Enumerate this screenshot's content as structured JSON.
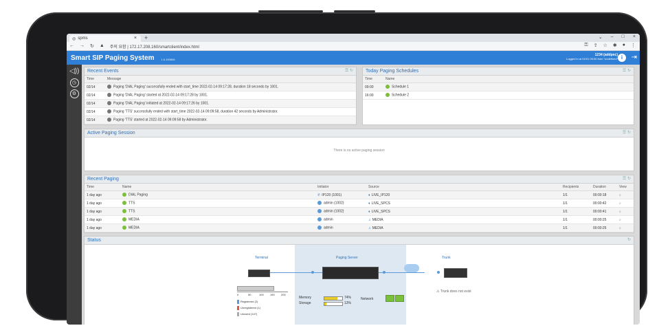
{
  "browser": {
    "tab_title": "spms",
    "new_tab": "+",
    "url": "주의 요함 | 172.17.208.160/smartclient/index.html"
  },
  "app": {
    "title": "Smart SIP Paging System",
    "version": "1.6.190806",
    "user_name": "1234 (addpec)",
    "login_info": "Logged in at 01/01 09:00 from \"undefined\""
  },
  "sidebar": {
    "items": [
      {
        "icon": "paging-icon"
      },
      {
        "icon": "clock-icon"
      },
      {
        "icon": "gear-icon"
      }
    ]
  },
  "recent_events": {
    "title": "Recent Events",
    "columns": [
      "Time",
      "Message"
    ],
    "rows": [
      {
        "time": "02/14",
        "message": "Paging 'DIAL Paging' successfully ended with start_time 2022-02-14 09:17:28, duration 18 seconds by 1001."
      },
      {
        "time": "02/14",
        "message": "Paging 'DIAL Paging' started at 2022-02-14 09:17:28 by 1001."
      },
      {
        "time": "02/14",
        "message": "Paging 'DIAL Paging' initiated at 2022-02-14 09:17:26 by 1001."
      },
      {
        "time": "02/14",
        "message": "Paging 'TTS' successfully ended with start_time 2022-02-14 09:09:58, duration 42 seconds by Administrator."
      },
      {
        "time": "02/14",
        "message": "Paging 'TTS' started at 2022-02-14 09:09:58 by Administrator."
      }
    ]
  },
  "schedules": {
    "title": "Today Paging Schedules",
    "columns": [
      "Time",
      "Name"
    ],
    "rows": [
      {
        "time": "09:00",
        "name": "Schedule 1"
      },
      {
        "time": "16:00",
        "name": "Schedule 2"
      }
    ]
  },
  "active_session": {
    "title": "Active Paging Session",
    "empty": "There is no active paging session"
  },
  "recent_paging": {
    "title": "Recent Paging",
    "columns": [
      "Time",
      "Name",
      "Initiator",
      "Source",
      "Recipients",
      "Duration",
      "View"
    ],
    "rows": [
      {
        "time": "1 day ago",
        "name": "DIAL Paging",
        "initiator": "IP120 (1001)",
        "source": "LIVE_IP120",
        "recipients": "1/1",
        "duration": "00:00:18"
      },
      {
        "time": "1 day ago",
        "name": "TTS",
        "initiator": "admin (1002)",
        "source": "LIVE_SPCS",
        "recipients": "1/1",
        "duration": "00:00:42"
      },
      {
        "time": "1 day ago",
        "name": "TTS",
        "initiator": "admin (1002)",
        "source": "LIVE_SPCS",
        "recipients": "1/1",
        "duration": "00:00:41"
      },
      {
        "time": "1 day ago",
        "name": "MEDIA",
        "initiator": "admin",
        "source": "MEDIA",
        "recipients": "1/1",
        "duration": "00:00:25"
      },
      {
        "time": "1 day ago",
        "name": "MEDIA",
        "initiator": "admin",
        "source": "MEDIA",
        "recipients": "1/1",
        "duration": "00:00:25"
      }
    ]
  },
  "status": {
    "title": "Status",
    "terminal_label": "Terminal",
    "server_label": "Paging Server",
    "trunk_label": "Trunk",
    "memory_label": "Memory",
    "memory_value": "74%",
    "memory_fraction": 0.74,
    "storage_label": "Storage",
    "storage_value": "13%",
    "storage_fraction": 0.13,
    "network_label": "Network",
    "trunk_note": "Trunk does not exist",
    "axis_ticks": [
      "0",
      "50",
      "100",
      "150",
      "200"
    ],
    "legend": [
      {
        "label": "Registered (2)",
        "color": "#5a9ad8"
      },
      {
        "label": "Unregistered (1)",
        "color": "#e0563f"
      },
      {
        "label": "Unused (147)",
        "color": "#aaaaaa"
      }
    ]
  }
}
